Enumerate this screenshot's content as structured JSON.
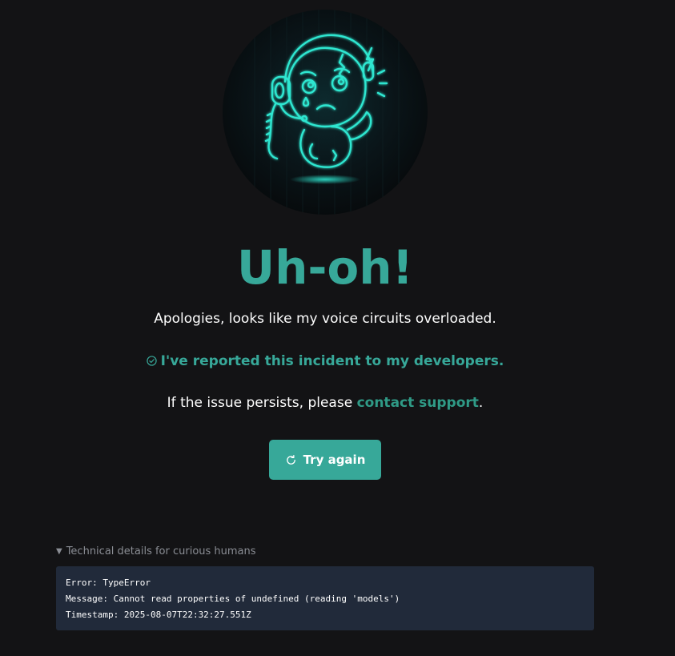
{
  "headline": "Uh-oh!",
  "apology": "Apologies, looks like my voice circuits overloaded.",
  "reported": {
    "icon": "check-circle-icon",
    "text": "I've reported this incident to my developers."
  },
  "persist": {
    "prefix": "If the issue persists, please ",
    "link": "contact support",
    "suffix": "."
  },
  "try_again": {
    "icon": "refresh-icon",
    "label": "Try again"
  },
  "technical": {
    "summary": "Technical details for curious humans",
    "expanded": true,
    "lines": [
      "Error: TypeError",
      "Message: Cannot read properties of undefined (reading 'models')",
      "Timestamp: 2025-08-07T22:32:27.551Z"
    ]
  },
  "colors": {
    "background": "#131315",
    "accent": "#37a899",
    "link": "#2f9a86",
    "code_background": "#212a3a",
    "muted_text": "#8a8d94"
  },
  "illustration": {
    "icon": "sad-robot-headset-icon"
  }
}
